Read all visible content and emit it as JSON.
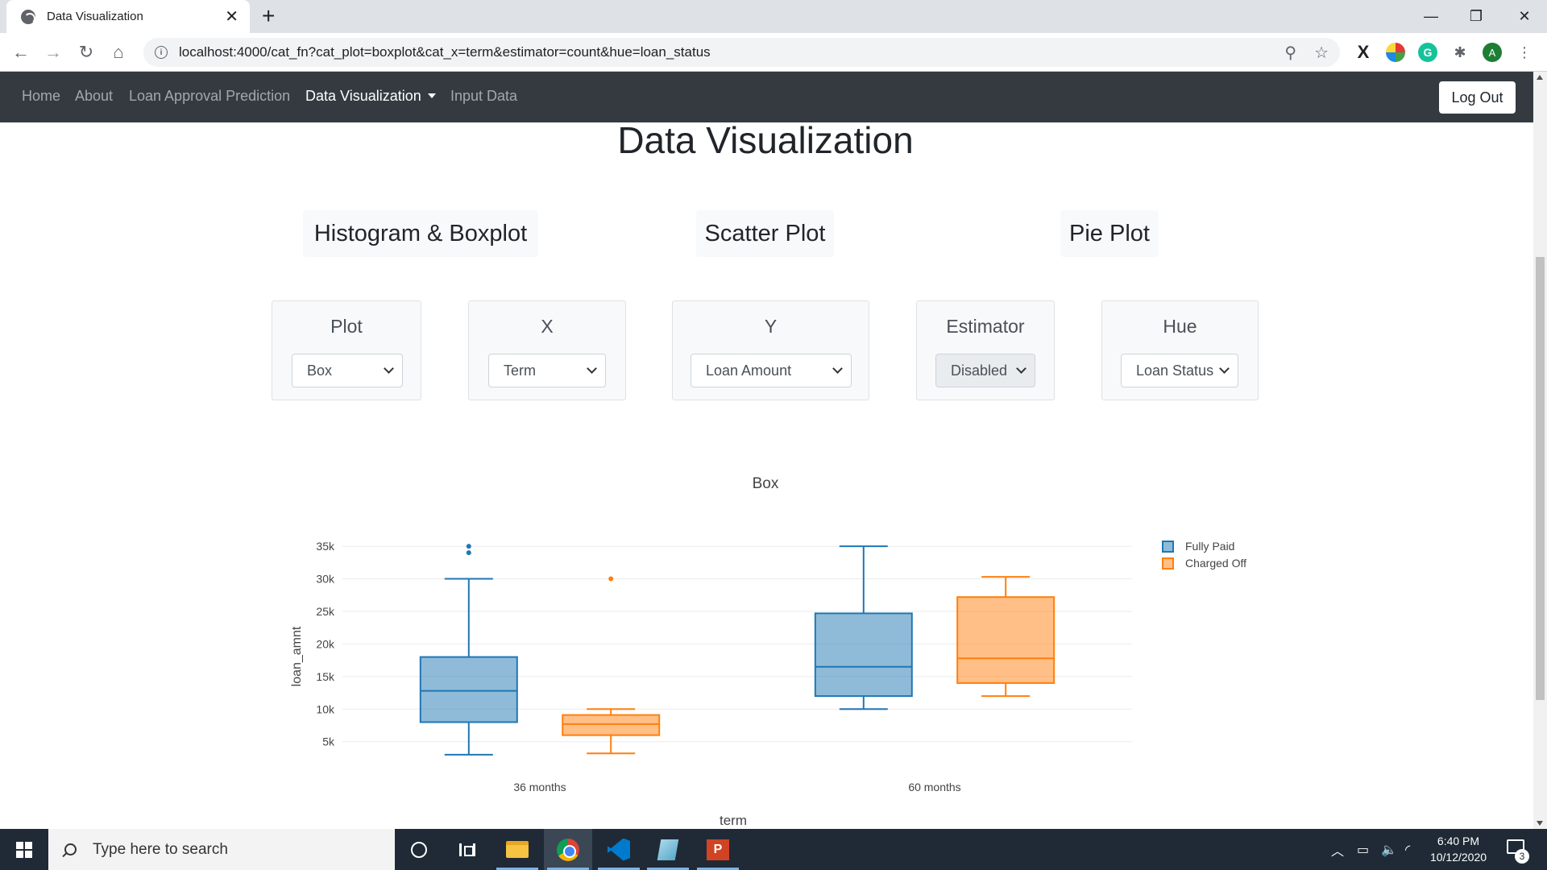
{
  "browser": {
    "tab_title": "Data Visualization",
    "tab_close": "✕",
    "new_tab": "+",
    "url": "localhost:4000/cat_fn?cat_plot=boxplot&cat_x=term&estimator=count&hue=loan_status",
    "window_controls": {
      "minimize": "—",
      "maximize": "❐",
      "close": "✕"
    }
  },
  "navbar": {
    "links": [
      "Home",
      "About",
      "Loan Approval Prediction",
      "Data Visualization",
      "Input Data"
    ],
    "active": "Data Visualization",
    "logout_label": "Log Out"
  },
  "page": {
    "title": "Data Visualization",
    "plot_tabs": [
      "Histogram & Boxplot",
      "Scatter Plot",
      "Pie Plot"
    ]
  },
  "controls": {
    "plot": {
      "label": "Plot",
      "value": "Box"
    },
    "x": {
      "label": "X",
      "value": "Term"
    },
    "y": {
      "label": "Y",
      "value": "Loan Amount"
    },
    "estimator": {
      "label": "Estimator",
      "value": "Disabled",
      "disabled": true
    },
    "hue": {
      "label": "Hue",
      "value": "Loan Status"
    }
  },
  "chart_data": {
    "type": "box",
    "title": "Box",
    "xlabel": "term",
    "ylabel": "loan_amnt",
    "categories": [
      "36 months",
      "60 months"
    ],
    "yticks": [
      5000,
      10000,
      15000,
      20000,
      25000,
      30000,
      35000
    ],
    "ytick_labels": [
      "5k",
      "10k",
      "15k",
      "20k",
      "25k",
      "30k",
      "35k"
    ],
    "ylim": [
      2000,
      36000
    ],
    "legend_position": "top-right",
    "grid": true,
    "series": [
      {
        "name": "Fully Paid",
        "color": "#1f77b4",
        "boxes": [
          {
            "category": "36 months",
            "min": 3000,
            "q1": 8000,
            "median": 12800,
            "q3": 18000,
            "max": 30000,
            "outliers": [
              34000,
              35000
            ]
          },
          {
            "category": "60 months",
            "min": 10000,
            "q1": 12000,
            "median": 16500,
            "q3": 24700,
            "max": 35000,
            "outliers": []
          }
        ]
      },
      {
        "name": "Charged Off",
        "color": "#ff7f0e",
        "boxes": [
          {
            "category": "36 months",
            "min": 3200,
            "q1": 6000,
            "median": 7700,
            "q3": 9100,
            "max": 10000,
            "outliers": [
              30000
            ]
          },
          {
            "category": "60 months",
            "min": 12000,
            "q1": 14000,
            "median": 17800,
            "q3": 27200,
            "max": 30300,
            "outliers": []
          }
        ]
      }
    ]
  },
  "taskbar": {
    "search_placeholder": "Type here to search",
    "time": "6:40 PM",
    "date": "10/12/2020",
    "notification_count": "3",
    "powerpoint_letter": "P"
  }
}
